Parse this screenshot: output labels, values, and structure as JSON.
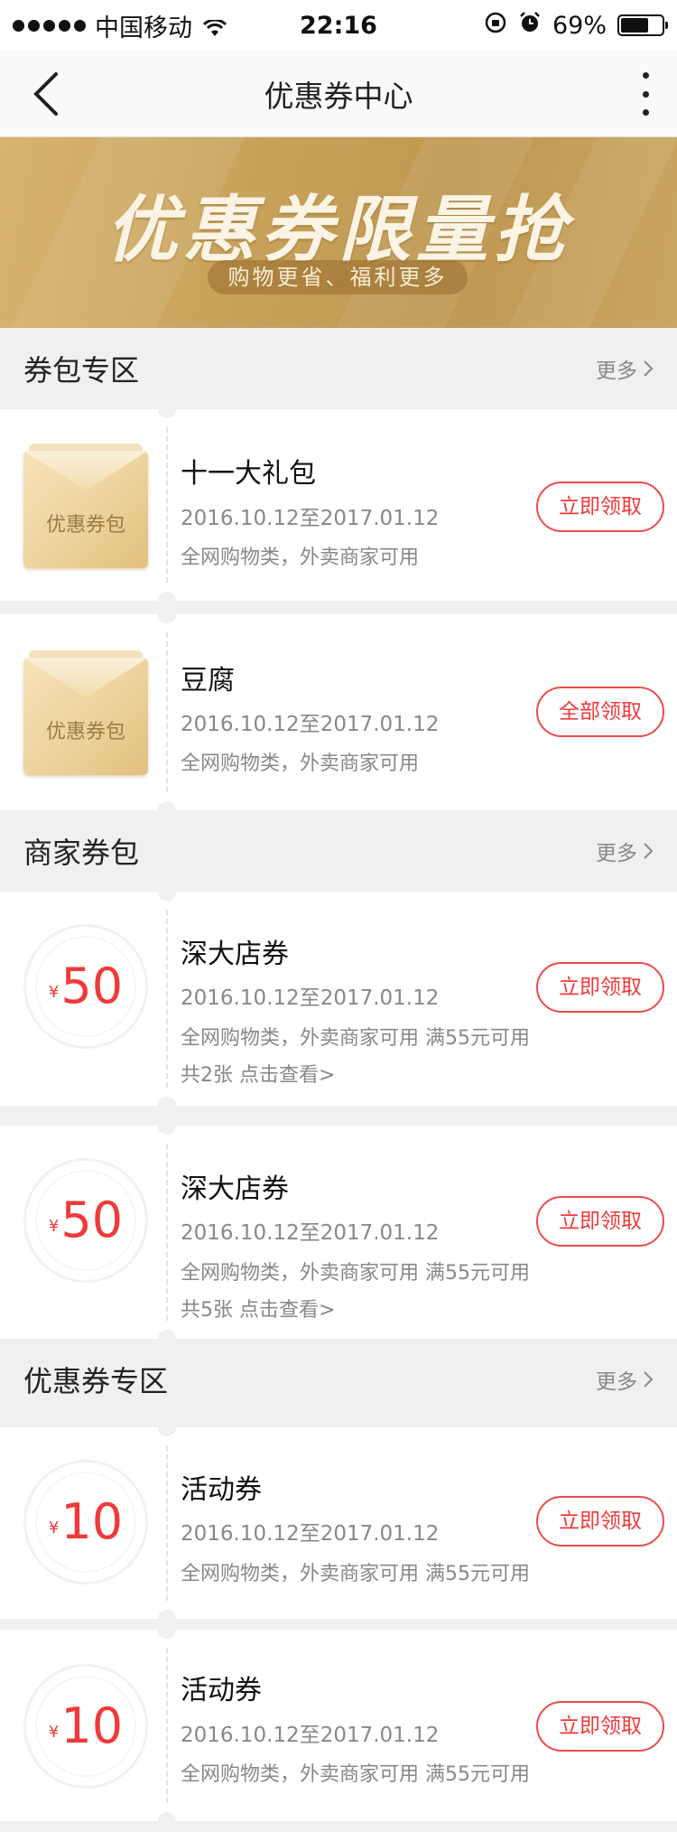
{
  "status_bar": {
    "carrier": "中国移动",
    "time": "22:16",
    "battery": "69%",
    "battery_level": 0.69
  },
  "nav": {
    "title": "优惠券中心"
  },
  "banner": {
    "title": "优惠券限量抢",
    "subtitle": "购物更省、福利更多"
  },
  "sections": [
    {
      "title": "券包专区",
      "more": "更多",
      "items": [
        {
          "pack_label": "优惠券包",
          "name": "十一大礼包",
          "date": "2016.10.12至2017.01.12",
          "desc": "全网购物类，外卖商家可用",
          "button": "立即领取"
        },
        {
          "pack_label": "优惠券包",
          "name": "豆腐",
          "date": "2016.10.12至2017.01.12",
          "desc": "全网购物类，外卖商家可用",
          "button": "全部领取"
        }
      ]
    },
    {
      "title": "商家券包",
      "more": "更多",
      "items": [
        {
          "currency": "¥",
          "amount": "50",
          "name": "深大店券",
          "date": "2016.10.12至2017.01.12",
          "desc": "全网购物类，外卖商家可用  满55元可用",
          "count": "共2张  点击查看>",
          "button": "立即领取"
        },
        {
          "currency": "¥",
          "amount": "50",
          "name": "深大店券",
          "date": "2016.10.12至2017.01.12",
          "desc": "全网购物类，外卖商家可用  满55元可用",
          "count": "共5张  点击查看>",
          "button": "立即领取"
        }
      ]
    },
    {
      "title": "优惠券专区",
      "more": "更多",
      "items": [
        {
          "currency": "¥",
          "amount": "10",
          "name": "活动券",
          "date": "2016.10.12至2017.01.12",
          "desc": "全网购物类，外卖商家可用  满55元可用",
          "button": "立即领取"
        },
        {
          "currency": "¥",
          "amount": "10",
          "name": "活动券",
          "date": "2016.10.12至2017.01.12",
          "desc": "全网购物类，外卖商家可用  满55元可用",
          "button": "立即领取"
        }
      ]
    }
  ],
  "colors": {
    "accent": "#f03a3a",
    "banner_gold": "#c9a35c",
    "background": "#f0f0f0"
  }
}
